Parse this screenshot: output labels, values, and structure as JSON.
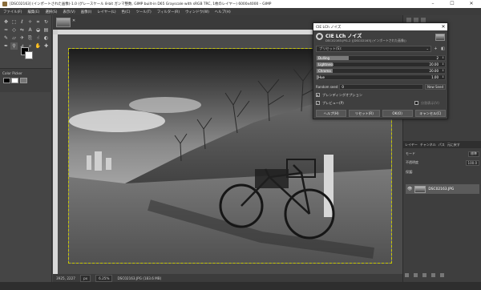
{
  "window": {
    "title": "[DSC02163] (インポートされた画像)-1.0 (グレースケール 8-bit ガンマ整数, GIMP built-in D65 Grayscale with sRGB TRC, 1枚のレイヤー) 6000x4000 – GIMP",
    "controls": {
      "minimize": "–",
      "maximize": "☐",
      "close": "✕"
    }
  },
  "menu": [
    "ファイル(F)",
    "編集(E)",
    "選択(S)",
    "表示(V)",
    "画像(I)",
    "レイヤー(L)",
    "色(C)",
    "ツール(T)",
    "フィルター(R)",
    "ウィンドウ(W)",
    "ヘルプ(H)"
  ],
  "toolbox": {
    "tools": [
      {
        "name": "move-tool-icon",
        "glyph": "✥"
      },
      {
        "name": "rect-select-icon",
        "glyph": "⬚"
      },
      {
        "name": "lasso-icon",
        "glyph": "ℓ"
      },
      {
        "name": "fuzzy-select-icon",
        "glyph": "✧"
      },
      {
        "name": "crop-icon",
        "glyph": "⌗"
      },
      {
        "name": "rotate-icon",
        "glyph": "↻"
      },
      {
        "name": "warp-icon",
        "glyph": "≈"
      },
      {
        "name": "perspective-icon",
        "glyph": "◇"
      },
      {
        "name": "flip-icon",
        "glyph": "⇋"
      },
      {
        "name": "text-icon",
        "glyph": "A"
      },
      {
        "name": "bucket-icon",
        "glyph": "◒"
      },
      {
        "name": "gradient-icon",
        "glyph": "▤"
      },
      {
        "name": "paintbrush-icon",
        "glyph": "✎"
      },
      {
        "name": "eraser-icon",
        "glyph": "▱"
      },
      {
        "name": "airbrush-icon",
        "glyph": "✈"
      },
      {
        "name": "clone-icon",
        "glyph": "⎘"
      },
      {
        "name": "smudge-icon",
        "glyph": "☝"
      },
      {
        "name": "dodge-icon",
        "glyph": "◐"
      },
      {
        "name": "path-icon",
        "glyph": "✒"
      },
      {
        "name": "color-picker-icon",
        "glyph": "⚲"
      },
      {
        "name": "measure-icon",
        "glyph": "⊿"
      },
      {
        "name": "zoom-icon",
        "glyph": "⌕"
      },
      {
        "name": "hand-icon",
        "glyph": "✋"
      },
      {
        "name": "heal-icon",
        "glyph": "✚"
      }
    ],
    "tool_options_title": "Color Picker"
  },
  "statusbar": {
    "coords": "3925, 2227",
    "unit": "px",
    "zoom": "6.25%",
    "info": "DSC02163.JPG (183.6 MB)"
  },
  "dock": {
    "tabs": [
      "レイヤー",
      "チャンネル",
      "パス",
      "元に戻す"
    ],
    "mode_label": "モード",
    "mode_value": "標準",
    "opacity_label": "不透明度",
    "opacity_value": "100.0",
    "lock_label": "保護:",
    "layer_name": "DSC02163.JPG"
  },
  "dialog": {
    "window_title": "CIE LCh ノイズ",
    "heading": "CIE LCh ノイズ",
    "subheading": "DSC02163.JPG-2 ([DSC02163] (インポートされた画像))",
    "preset_label": "プリセット(S):",
    "params": [
      {
        "label": "Dulling",
        "value": "2"
      },
      {
        "label": "Lightness",
        "value": "20.00"
      },
      {
        "label": "Chroma",
        "value": "20.00"
      },
      {
        "label": "Hue",
        "value": "1.00"
      }
    ],
    "seed_label": "Random seed",
    "seed_value": "0",
    "new_seed_label": "New Seed",
    "blend_label": "ブレンディングオプション",
    "preview_label": "プレビュー(P)",
    "split_label": "分割表示(V)",
    "buttons": {
      "help": "ヘルプ(H)",
      "reset": "リセット(R)",
      "ok": "OK(O)",
      "cancel": "キャンセル(C)"
    }
  }
}
